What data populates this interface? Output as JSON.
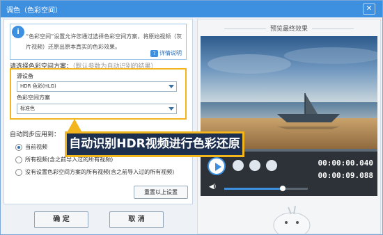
{
  "window": {
    "title": "调色（色彩空间）",
    "close_label": "✕"
  },
  "info": {
    "text": "“色彩空间”设置允许您通过选择色彩空间方案，将原始视频（灰片视频）还原出原本真实的色彩效果。",
    "help_label": "详情说明",
    "icon": "info-icon"
  },
  "scheme": {
    "label": "请选择色彩空间方案：",
    "hint": "（默认参数为自动识别的结果）",
    "source_label": "源设备",
    "source_value": "HDR 色彩(HLG)",
    "space_label": "色彩空间方案",
    "space_value": "标准色"
  },
  "apply": {
    "label": "自动同步应用到：",
    "options": [
      "当前视频",
      "所有视频(含之前导入过的所有视频)",
      "没有设置色彩空间方案的所有视频(含之前导入过的所有视频)"
    ],
    "selected": 0,
    "reset_label": "重置以上设置"
  },
  "buttons": {
    "ok": "确 定",
    "cancel": "取 消"
  },
  "preview": {
    "title": "预览最终效果",
    "current_time": "00:00:00.040",
    "total_time": "00:00:09.088",
    "volume_level": 0.7
  },
  "banner": {
    "text": "自动识别HDR视频进行色彩还原"
  },
  "colors": {
    "accent": "#3d8fe0",
    "highlight": "#f2b51d",
    "banner_bg": "#1d2f4e"
  }
}
